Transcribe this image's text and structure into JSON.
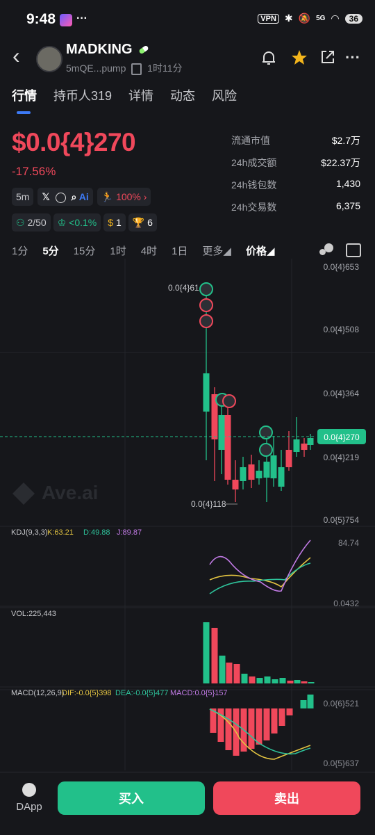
{
  "status_bar": {
    "time": "9:48",
    "dots": "···",
    "vpn": "VPN",
    "signal": "5G",
    "battery": "36"
  },
  "header": {
    "back": "‹",
    "title": "MADKING",
    "subtitle": "5mQE...pump",
    "age": "1时11分"
  },
  "tabs": [
    "行情",
    "持币人319",
    "详情",
    "动态",
    "风险"
  ],
  "price": {
    "value": "$0.0{4}270",
    "change": "-17.56%"
  },
  "chips_row1": {
    "interval": "5m",
    "pct": "100%"
  },
  "chips_row2": {
    "holders": "2/50",
    "cook": "<0.1%",
    "money": "1",
    "trophy": "6"
  },
  "stats": [
    {
      "label": "流通市值",
      "value": "$2.7万"
    },
    {
      "label": "24h成交额",
      "value": "$22.37万"
    },
    {
      "label": "24h钱包数",
      "value": "1,430"
    },
    {
      "label": "24h交易数",
      "value": "6,375"
    }
  ],
  "timeframes": [
    "1分",
    "5分",
    "15分",
    "1时",
    "4时",
    "1日",
    "更多",
    "价格"
  ],
  "chart_data": {
    "type": "candlestick",
    "y_ticks": [
      "0.0{4}653",
      "0.0{4}508",
      "0.0{4}364",
      "0.0{4}219",
      "0.0{5}754"
    ],
    "current_price": "0.0{4}270",
    "high_label": "0.0{4}61",
    "low_label": "0.0{4}118",
    "watermark": "Ave.ai",
    "kdj": {
      "label": "KDJ(9,3,3)",
      "k": "K:63.21",
      "d": "D:49.88",
      "j": "J:89.87",
      "top": "84.74",
      "bottom": "0.0432"
    },
    "vol": {
      "label": "VOL:225,443"
    },
    "macd": {
      "label": "MACD(12,26,9)",
      "dif": "DIF:-0.0{5}398",
      "dea": "DEA:-0.0{5}477",
      "macd": "MACD:0.0{5}157",
      "top": "0.0{6}521",
      "bottom": "0.0{5}637"
    },
    "colors": {
      "up": "#22c08a",
      "down": "#f0485b",
      "k": "#e2c341",
      "d": "#2ec39b",
      "j": "#c27be6"
    }
  },
  "bottom": {
    "dapp": "DApp",
    "buy": "买入",
    "sell": "卖出"
  }
}
